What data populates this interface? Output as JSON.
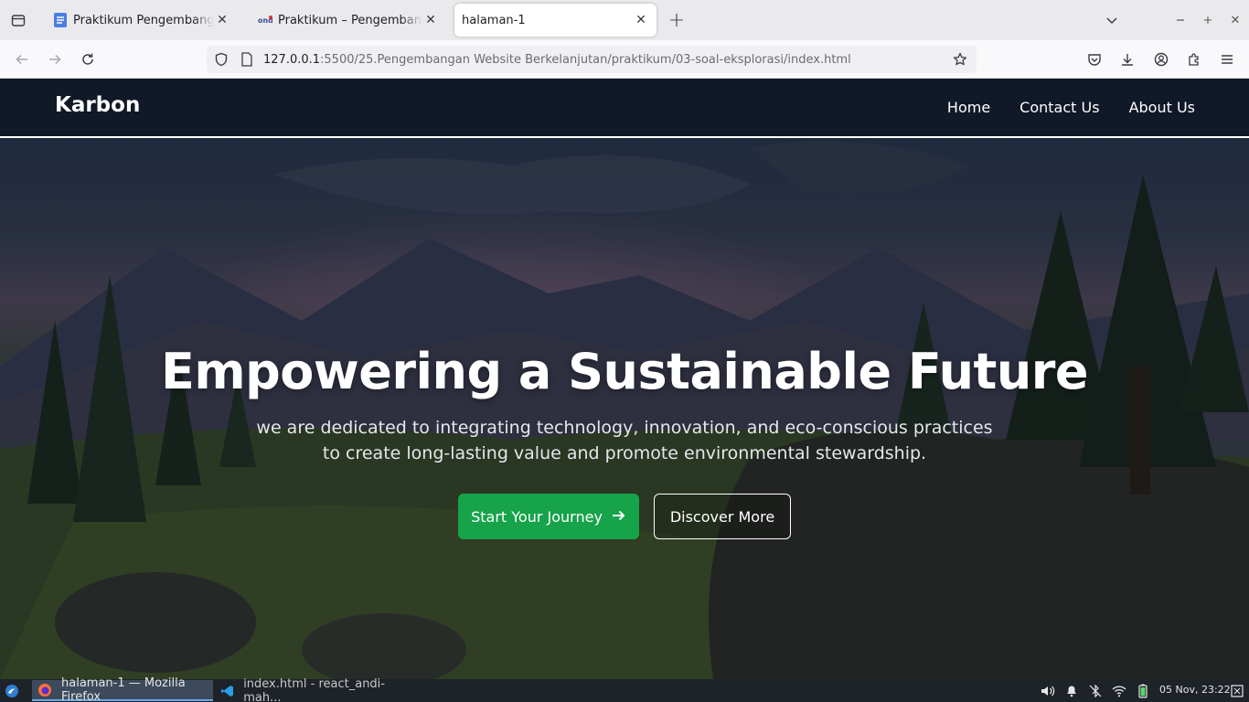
{
  "browser": {
    "tabs": [
      {
        "title": "Praktikum Pengembangan Website",
        "favicon": "doc-icon"
      },
      {
        "title": "Praktikum – Pengembangan Website",
        "favicon": "site-logo-icon"
      },
      {
        "title": "halaman-1",
        "active": true
      }
    ],
    "url_host": "127.0.0.1",
    "url_rest": ":5500/25.Pengembangan Website Berkelanjutan/praktikum/03-soal-eksplorasi/index.html"
  },
  "site": {
    "brand": "Karbon",
    "nav": [
      "Home",
      "Contact Us",
      "About Us"
    ],
    "hero": {
      "title": "Empowering a Sustainable Future",
      "subtitle": "we are dedicated to integrating technology, innovation, and eco-conscious practices to create long-lasting value and promote environmental stewardship.",
      "primary_cta": "Start Your Journey",
      "secondary_cta": "Discover More"
    },
    "colors": {
      "header_bg": "#111827",
      "primary": "#16a34a"
    }
  },
  "taskbar": {
    "tasks": [
      "halaman-1 — Mozilla Firefox",
      "index.html - react_andi-mah..."
    ],
    "clock": "05 Nov, 23:22"
  }
}
